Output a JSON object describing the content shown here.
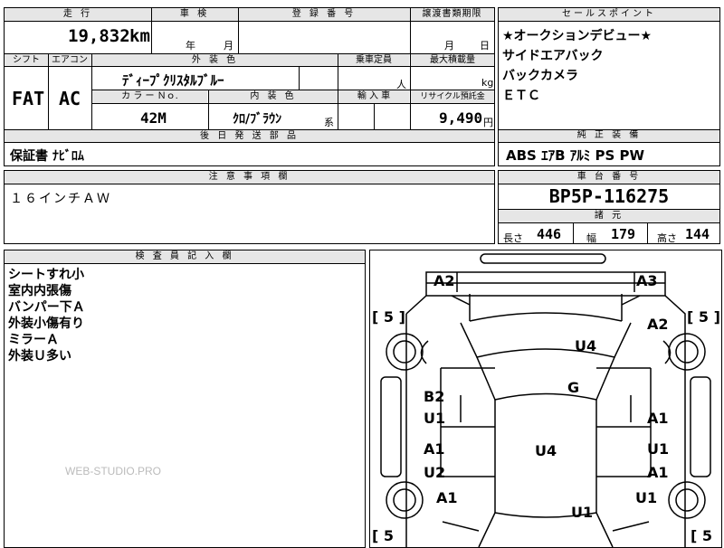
{
  "main": {
    "mileage_hdr": "走 行",
    "mileage_val": "19,832",
    "mileage_unit": "km",
    "inspection_hdr": "車 検",
    "inspection_year": "年",
    "inspection_month": "月",
    "reg_hdr": "登 録 番 号",
    "transfer_hdr": "譲渡書類期限",
    "transfer_month": "月",
    "transfer_day": "日",
    "shift_hdr": "シフト",
    "ac_hdr": "エアコン",
    "shift_val": "FAT",
    "ac_val": "AC",
    "exterior_hdr": "外 装 色",
    "exterior_val": "ﾃﾞｨｰﾌﾟｸﾘｽﾀﾙﾌﾞﾙｰ",
    "capacity_hdr": "乗車定員",
    "capacity_unit": "人",
    "load_hdr": "最大積載量",
    "load_unit": "kg",
    "color_no_hdr": "カ ラ ー Ｎｏ.",
    "interior_hdr": "内 装 色",
    "import_hdr": "輸 入 車",
    "recycle_hdr": "リサイクル預託金",
    "color_no_val": "42M",
    "interior_val": "ｸﾛ/ﾌﾞﾗｳﾝ",
    "interior_suffix": "系",
    "recycle_val": "9,490",
    "recycle_unit": "円",
    "later_hdr": "後 日 発 送 部 品",
    "later_val": "保証書 ﾅﾋﾞﾛﾑ"
  },
  "sales": {
    "hdr": "セールスポイント",
    "lines": [
      "★オークションデビュー★",
      "サイドエアバック",
      "バックカメラ",
      "ＥＴＣ"
    ]
  },
  "equipment": {
    "hdr": "純 正 装 備",
    "val": "ABS ｴｱB ｱﾙﾐ PS PW"
  },
  "notes": {
    "hdr": "注 意 事 項 欄",
    "val": "１６インチＡＷ"
  },
  "chassis": {
    "hdr": "車 台 番 号",
    "val": "BP5P-116275",
    "spec_hdr": "諸 元",
    "len_label": "長さ",
    "len_val": "446",
    "width_label": "幅",
    "width_val": "179",
    "height_label": "高さ",
    "height_val": "144"
  },
  "inspector": {
    "hdr": "検 査 員 記 入 欄",
    "lines": [
      "シートすれ小",
      "室内内張傷",
      "バンパー下Ａ",
      "外装小傷有り",
      "ミラーＡ",
      "外装Ｕ多い"
    ]
  },
  "diagram": {
    "marks": {
      "a2_left": "A2",
      "a3_right": "A3",
      "u4_top": "U4",
      "a2_right": "A2",
      "g_center": "G",
      "b2_left": "B2",
      "u1_left_a": "U1",
      "a1_right_a": "A1",
      "a1_left_b": "A1",
      "u4_center": "U4",
      "u1_right_b": "U1",
      "u2_left": "U2",
      "a1_right_c": "A1",
      "a1_left_d": "A1",
      "u1_right_d": "U1",
      "u1_bottom": "U1"
    },
    "tires": {
      "tl": "[ 5 ]",
      "tr": "[ 5 ]",
      "bl": "[ 5",
      "br": "[ 5"
    }
  },
  "watermark": "WEB-STUDIO.PRO"
}
